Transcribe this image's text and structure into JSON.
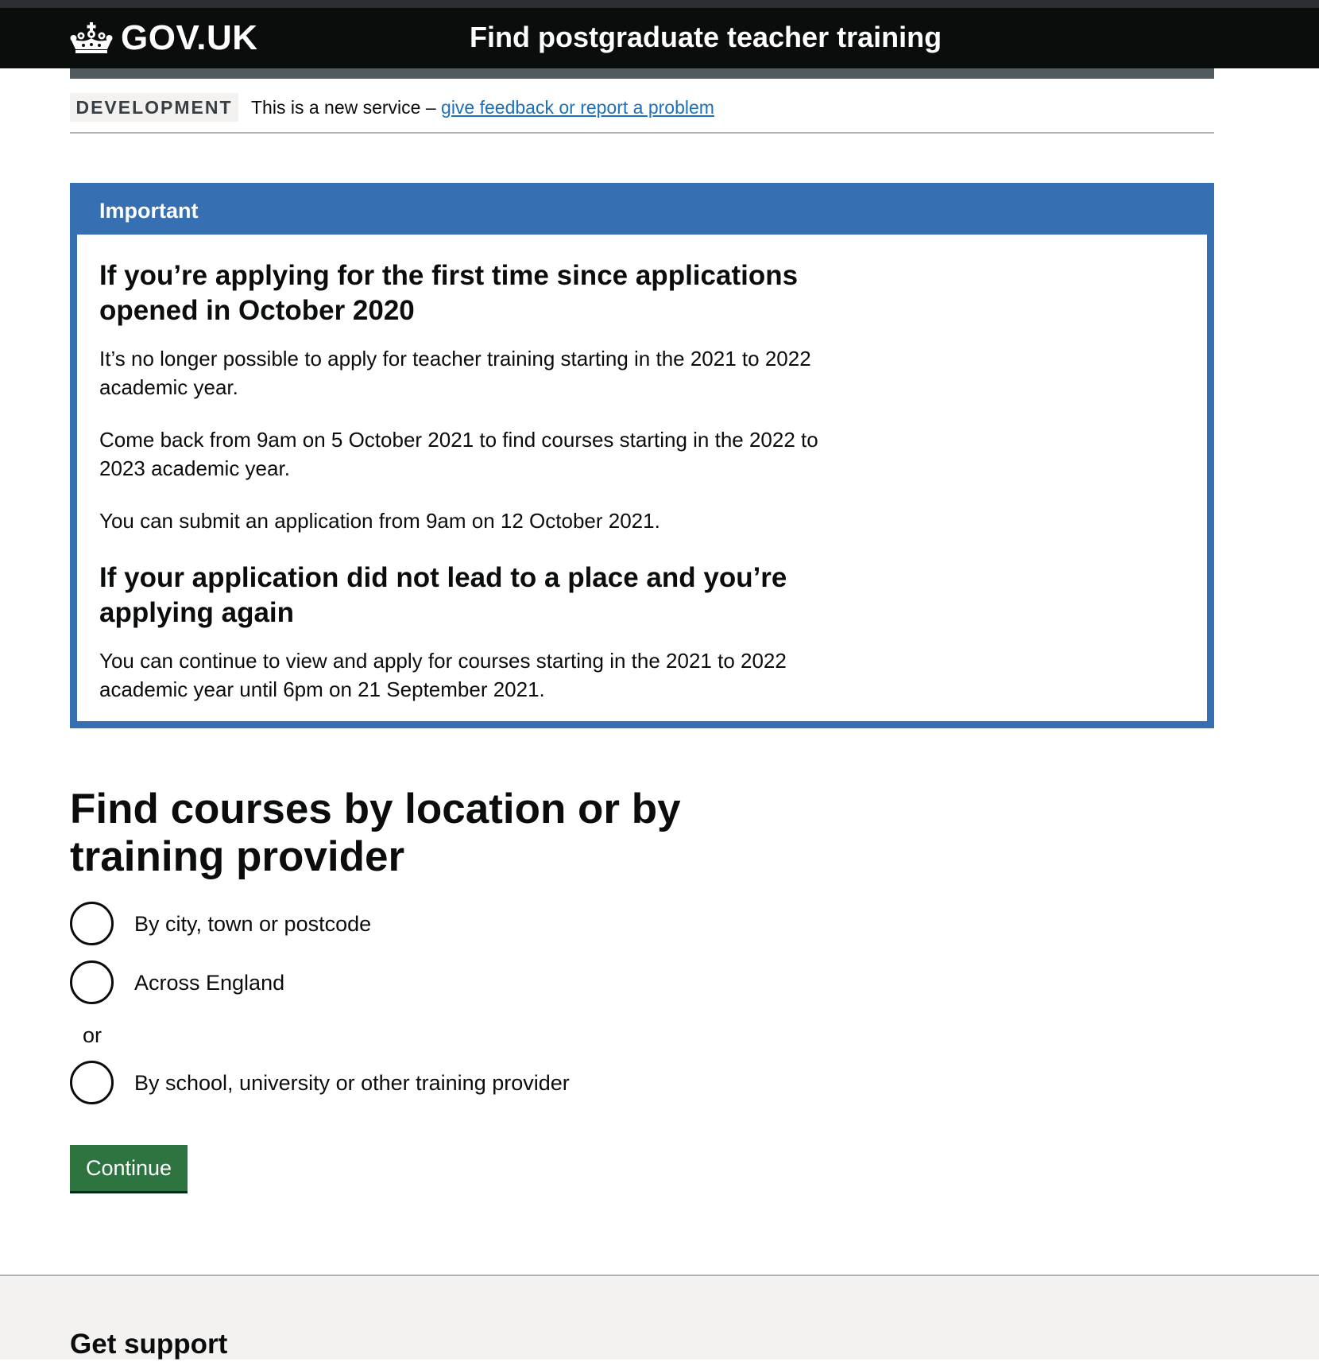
{
  "header": {
    "logo_text": "GOV.UK",
    "service_name": "Find postgraduate teacher training"
  },
  "phase_banner": {
    "tag": "DEVELOPMENT",
    "text": "This is a new service – ",
    "link_text": "give feedback or report a problem"
  },
  "notice": {
    "title": "Important",
    "heading_1": "If you’re applying for the first time since applications opened in October 2020",
    "paragraph_1": "It’s no longer possible to apply for teacher training starting in the 2021 to 2022 academic year.",
    "paragraph_2": "Come back from 9am on 5 October 2021 to find courses starting in the 2022 to 2023 academic year.",
    "paragraph_3": "You can submit an application from 9am on 12 October 2021.",
    "heading_2": "If your application did not lead to a place and you’re applying again",
    "paragraph_4": "You can continue to view and apply for courses starting in the 2021 to 2022 academic year until 6pm on 21 September 2021."
  },
  "search": {
    "heading": "Find courses by location or by training provider",
    "options": [
      {
        "label": "By city, town or postcode",
        "selected": false
      },
      {
        "label": "Across England",
        "selected": false
      },
      {
        "label": "By school, university or other training provider",
        "selected": false
      }
    ],
    "or_divider": "or",
    "continue_label": "Continue"
  },
  "footer": {
    "heading": "Get support"
  },
  "colors": {
    "header_bg": "#0b0c0c",
    "notice_blue": "#3670b2",
    "link_blue": "#1d70b8",
    "button_green": "#2e7440",
    "footer_bg": "#f3f2f1"
  },
  "icons": {
    "logo": "crown-icon"
  }
}
